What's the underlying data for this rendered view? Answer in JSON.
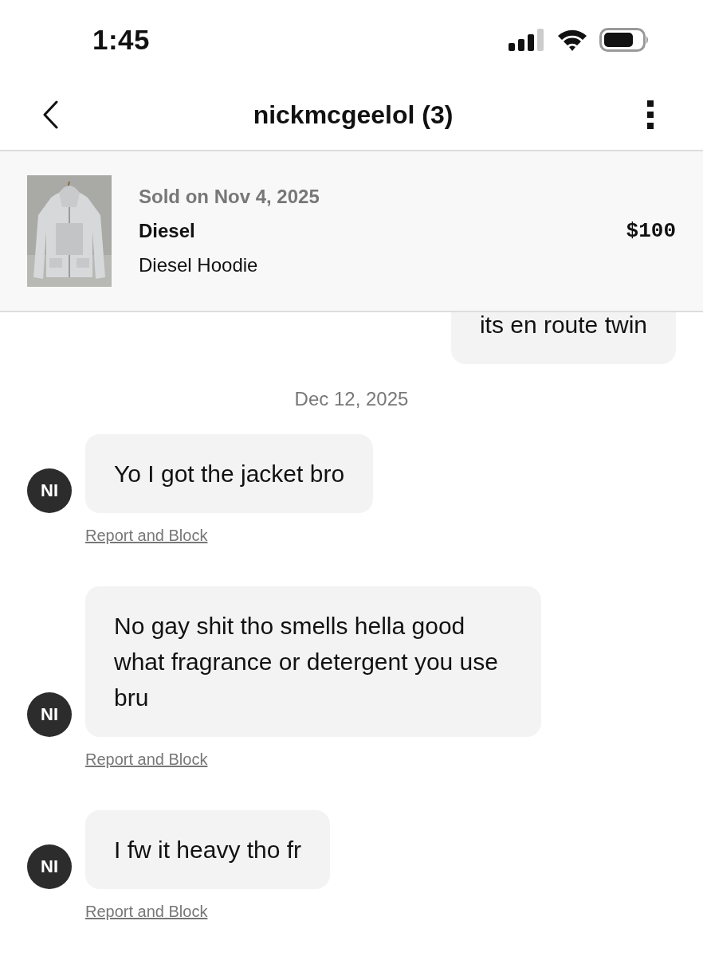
{
  "status_bar": {
    "time": "1:45"
  },
  "header": {
    "title": "nickmcgeelol (3)"
  },
  "listing": {
    "sold": "Sold on Nov 4, 2025",
    "brand": "Diesel",
    "title": "Diesel Hoodie",
    "price": "$100"
  },
  "messages": [
    {
      "kind": "sent",
      "text": "its en route twin"
    },
    {
      "kind": "date",
      "text": "Dec 12, 2025"
    },
    {
      "kind": "received",
      "avatar": "NI",
      "text": "Yo I got the jacket bro",
      "action": "Report and Block"
    },
    {
      "kind": "received",
      "avatar": "NI",
      "text": "No gay shit tho smells hella good what fragrance or detergent you use bru",
      "action": "Report and Block"
    },
    {
      "kind": "received",
      "avatar": "NI",
      "text": "I fw it heavy tho fr",
      "action": "Report and Block"
    }
  ]
}
